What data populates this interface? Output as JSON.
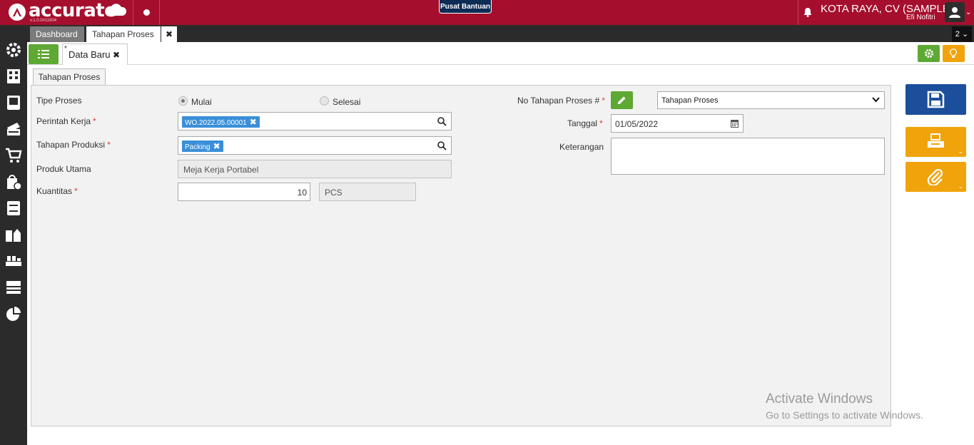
{
  "header": {
    "brand": "accurate",
    "brand_suffix": "online",
    "version": "v.1.0.0#11604",
    "help_label": "Pusat Bantuan",
    "company": "KOTA RAYA, CV (SAMPLE)",
    "user": "Efi Nofitri",
    "accent": "#a50f2d"
  },
  "tabs": {
    "dashboard": "Dashboard",
    "active": "Tahapan Proses",
    "close": "✖",
    "count": "2"
  },
  "doc": {
    "modified_mark": "*",
    "title": "Data Baru",
    "close": "✖"
  },
  "form": {
    "inner_tab": "Tahapan Proses",
    "tipe_proses_label": "Tipe Proses",
    "radio_mulai": "Mulai",
    "radio_selesai": "Selesai",
    "selected_tipe": "Mulai",
    "perintah_kerja_label": "Perintah Kerja",
    "perintah_kerja_value": "WO.2022.05.00001",
    "tahapan_produksi_label": "Tahapan Produksi",
    "tahapan_produksi_value": "Packing",
    "produk_utama_label": "Produk Utama",
    "produk_utama_value": "Meja Kerja Portabel",
    "kuantitas_label": "Kuantitas",
    "kuantitas_value": "10",
    "satuan_value": "PCS",
    "no_label": "No Tahapan Proses #",
    "no_select_value": "Tahapan Proses",
    "tanggal_label": "Tanggal",
    "tanggal_value": "01/05/2022",
    "keterangan_label": "Keterangan",
    "keterangan_value": "",
    "required_mark": "*",
    "chip_remove": "✖"
  },
  "watermark": {
    "line1": "Activate Windows",
    "line2": "Go to Settings to activate Windows."
  },
  "icons": [
    "logo-icon",
    "bell-icon",
    "user-icon",
    "settings-icon",
    "building-icon",
    "book-icon",
    "cards-icon",
    "cart-icon",
    "bag-icon",
    "archive-icon",
    "office-icon",
    "factory-icon",
    "tax-icon",
    "pie-chart-icon",
    "list-icon",
    "gear-icon",
    "bulb-icon",
    "edit-icon",
    "search-icon",
    "calendar-icon",
    "chevron-down-icon",
    "save-icon",
    "print-icon",
    "paperclip-icon"
  ]
}
